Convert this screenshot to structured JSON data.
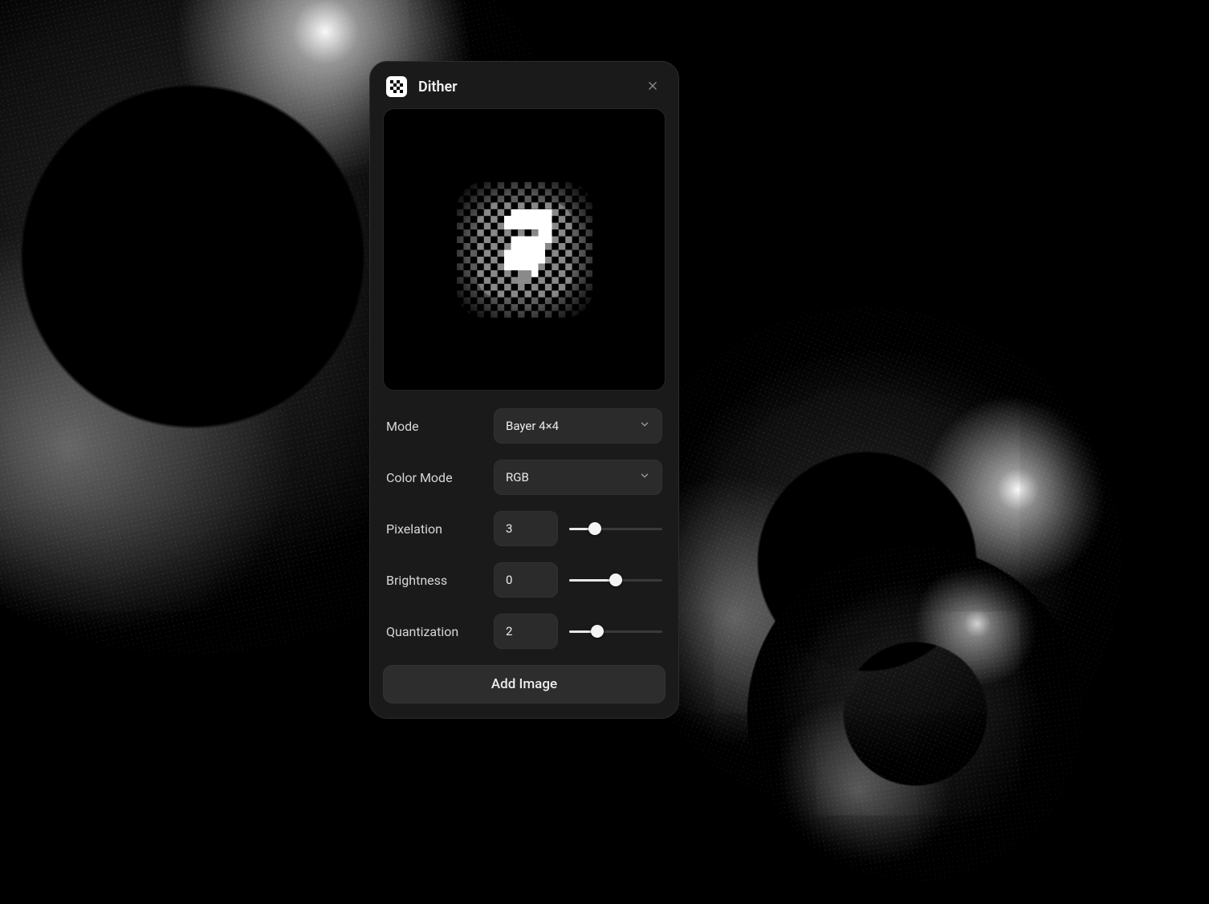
{
  "panel": {
    "title": "Dither"
  },
  "controls": {
    "mode": {
      "label": "Mode",
      "value": "Bayer 4×4"
    },
    "color_mode": {
      "label": "Color Mode",
      "value": "RGB"
    },
    "pixelation": {
      "label": "Pixelation",
      "value": "3",
      "percent": 28
    },
    "brightness": {
      "label": "Brightness",
      "value": "0",
      "percent": 50
    },
    "quantization": {
      "label": "Quantization",
      "value": "2",
      "percent": 30
    }
  },
  "actions": {
    "add_image": "Add Image"
  }
}
